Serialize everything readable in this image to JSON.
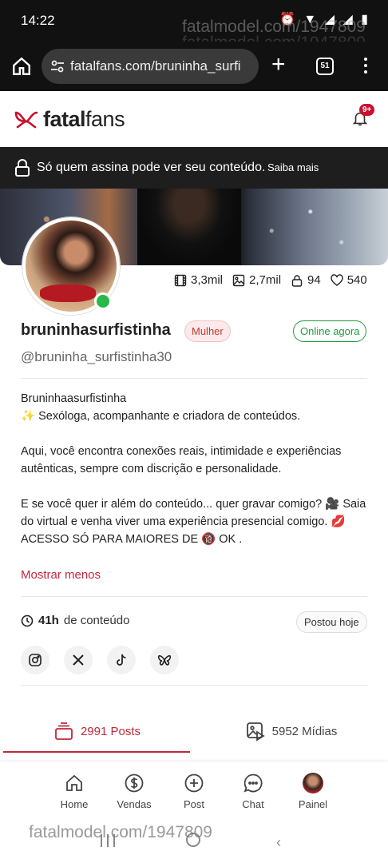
{
  "status_bar": {
    "time": "14:22",
    "icons": "⏰ ▼ ◢ ◢ ▮"
  },
  "watermark": "fatalmodel.com/1947809",
  "browser": {
    "url": "fatalfans.com/bruninha_surfi",
    "tab_count": "51"
  },
  "header": {
    "brand_bold": "fatal",
    "brand_light": "fans",
    "notification_badge": "9+"
  },
  "lock_banner": {
    "message": "Só quem assina pode ver seu conteúdo.",
    "link": "Saiba mais"
  },
  "profile": {
    "stats": {
      "videos": "3,3mil",
      "photos": "2,7mil",
      "locked": "94",
      "likes": "540"
    },
    "username": "bruninhasurfistinha",
    "gender_tag": "Mulher",
    "online_tag": "Online agora",
    "handle": "@bruninha_surfistinha30",
    "bio": {
      "line1": "Bruninhaasurfistinha",
      "line2": "✨ Sexóloga, acompanhante e criadora de conteúdos.",
      "line3": "Aqui, você encontra conexões reais, intimidade e experiências autênticas, sempre com discrição e personalidade.",
      "line4": "E se você quer ir além do conteúdo... quer gravar comigo? 🎥 Saia do virtual e venha viver uma experiência presencial comigo. 💋",
      "line5": "ACESSO SÓ PARA MAIORES DE 🔞 OK ."
    },
    "show_less": "Mostrar menos",
    "content_hours": "41h",
    "content_label": "de conteúdo",
    "posted_tag": "Postou hoje"
  },
  "tabs": {
    "posts": "2991 Posts",
    "media": "5952 Mídias"
  },
  "bottom_nav": {
    "home": "Home",
    "sales": "Vendas",
    "post": "Post",
    "chat": "Chat",
    "panel": "Painel"
  },
  "colors": {
    "accent": "#c0283b",
    "online": "#1e9a3d"
  }
}
